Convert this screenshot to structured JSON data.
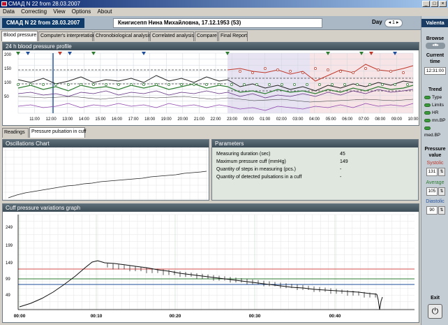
{
  "window": {
    "title": "СМАД  N 22 from 28.03.2007"
  },
  "menu": [
    "Data",
    "Correcting",
    "View",
    "Options",
    "About"
  ],
  "header": {
    "record": "СМАД  N 22 from 28.03.2007",
    "patient": "Книгисепп Нина Михайловна, 17.12.1953 (53)",
    "day_label": "Day",
    "day_value": "1"
  },
  "tabs": [
    "Blood pressure",
    "Computer's interpretation",
    "Chronobiological analysis",
    "Correlated analysis",
    "Compare",
    "Final Report"
  ],
  "profile": {
    "title": "24 h blood pressure profile",
    "y_ticks": [
      "200",
      "150",
      "100",
      "50"
    ],
    "x_ticks": [
      "11:00",
      "12:00",
      "13:00",
      "14:00",
      "15:00",
      "16:00",
      "17:00",
      "18:00",
      "19:00",
      "20:00",
      "21:00",
      "22:00",
      "23:00",
      "00:00",
      "01:00",
      "02:00",
      "03:00",
      "04:00",
      "05:00",
      "06:00",
      "07:00",
      "08:00",
      "09:00",
      "10:00"
    ]
  },
  "subtabs": [
    "Readings",
    "Pressure pulsation in cuff"
  ],
  "oscillations": {
    "title": "Oscillations Chart"
  },
  "parameters": {
    "title": "Parameters",
    "rows": [
      {
        "label": "Measuring duration (sec)",
        "value": "45"
      },
      {
        "label": "Maximum pressure cuff (mmHg)",
        "value": "149"
      },
      {
        "label": "Quantity of steps in measuring (pcs.)",
        "value": "-"
      },
      {
        "label": "Quantity of detected pulsations in a cuff",
        "value": "-"
      }
    ]
  },
  "cuff": {
    "title": "Cuff pressure variations graph",
    "y_ticks": [
      "249",
      "199",
      "149",
      "99",
      "49"
    ],
    "x_ticks": [
      "00:00",
      "00:10",
      "00:20",
      "00:30",
      "00:40"
    ]
  },
  "sidebar": {
    "brand": "Valenta",
    "browse": "Browse",
    "current_time_label": "Current time",
    "current_time": "12:31:00",
    "trend_label": "Trend",
    "trend_items": [
      "Type",
      "Limits",
      "HR",
      "mn.BP",
      "med.BP"
    ],
    "pressure_label": "Pressure value",
    "systolic_label": "Systolic",
    "systolic": "131",
    "average_label": "Average",
    "average": "105",
    "diastolic_label": "Diastolic",
    "diastolic": "90",
    "exit_label": "Exit",
    "colors": {
      "systolic": "#c0392b",
      "average": "#2e7d32",
      "diastolic": "#1f4e9a"
    }
  }
}
